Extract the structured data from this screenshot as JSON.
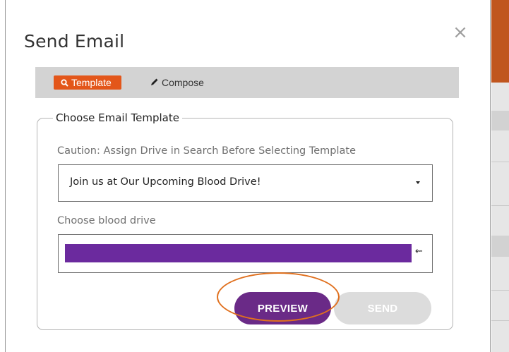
{
  "modal": {
    "title": "Send Email",
    "close_label": "×"
  },
  "tabs": [
    {
      "label": "Template",
      "icon": "search-icon",
      "active": true
    },
    {
      "label": "Compose",
      "icon": "pencil-icon",
      "active": false
    }
  ],
  "template_section": {
    "legend": "Choose Email Template",
    "caution": "Caution: Assign Drive in Search Before Selecting Template",
    "selected_template": "Join us at Our Upcoming Blood Drive!",
    "drive_label": "Choose blood drive",
    "drive_clear_glyph": "⇜"
  },
  "actions": {
    "preview_label": "PREVIEW",
    "send_label": "SEND"
  },
  "colors": {
    "template_tab": "#e3561a",
    "preview_button": "#6a2a87",
    "send_button_disabled": "#dcdcdc",
    "drive_fill": "#6b2a9e",
    "highlight": "#e0701e"
  }
}
